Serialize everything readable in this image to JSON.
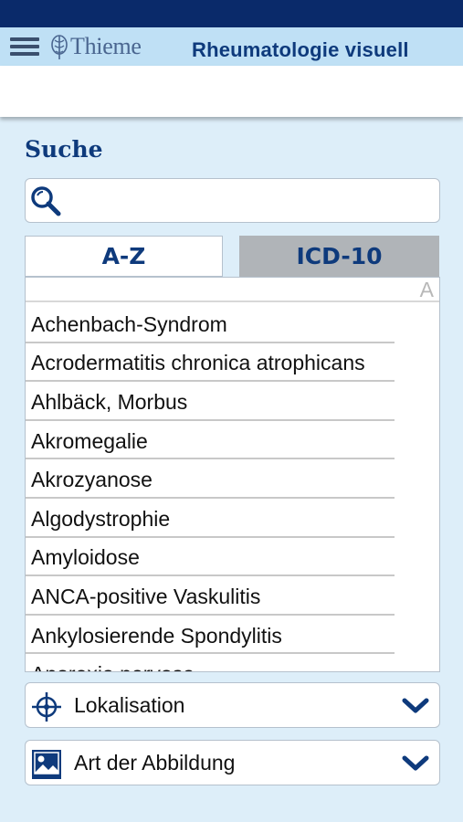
{
  "header": {
    "brand": "Thieme",
    "title": "Rheumatologie visuell"
  },
  "search": {
    "title": "Suche",
    "placeholder": ""
  },
  "tabs": [
    {
      "label": "A-Z",
      "selected": true
    },
    {
      "label": "ICD-10",
      "selected": false
    }
  ],
  "index_letter": "A",
  "list": [
    "Achenbach-Syndrom",
    "Acrodermatitis chronica atrophicans",
    "Ahlbäck, Morbus",
    "Akromegalie",
    "Akrozyanose",
    "Algodystrophie",
    "Amyloidose",
    "ANCA-positive Vaskulitis",
    "Ankylosierende Spondylitis",
    "Anorexia nervosa"
  ],
  "filters": {
    "lokalisation": {
      "label": "Lokalisation",
      "icon": "crosshair-icon"
    },
    "art": {
      "label": "Art der Abbildung",
      "icon": "image-icon"
    }
  },
  "colors": {
    "status_bar": "#0a2a6a",
    "header_bg": "#bfe0f5",
    "page_bg": "#ddeef9",
    "accent": "#0e3a7c",
    "tab_inactive": "#b0b4b8"
  }
}
